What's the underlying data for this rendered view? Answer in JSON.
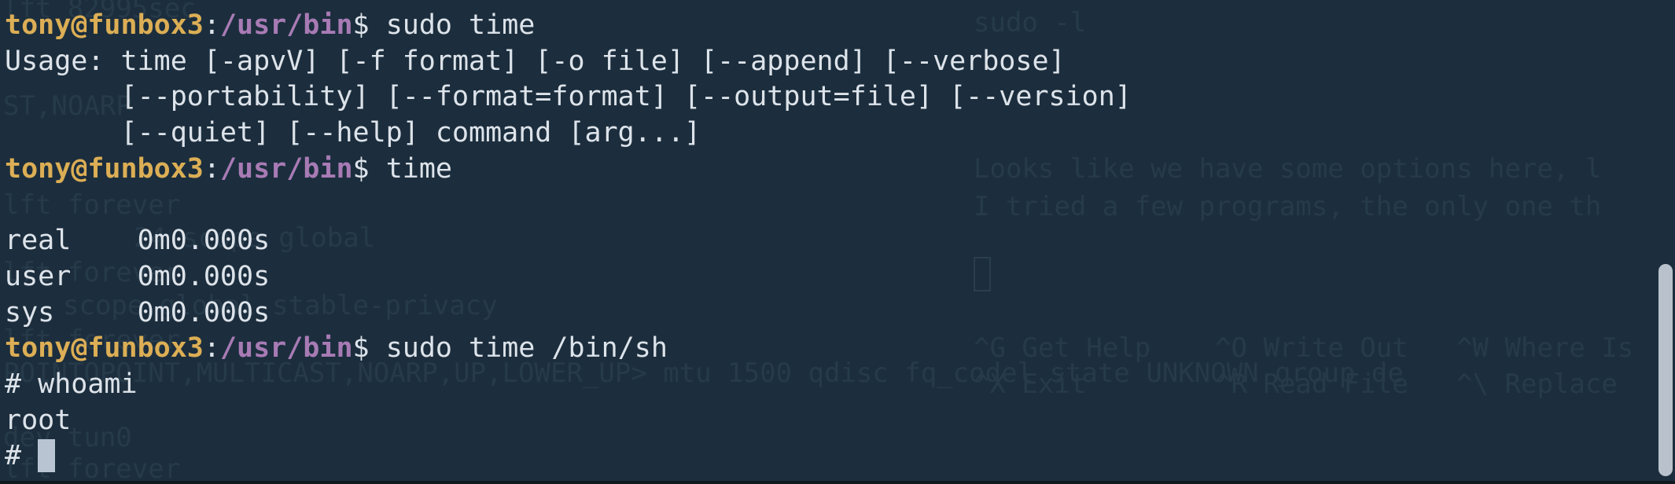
{
  "prompt": {
    "user_host": "tony@funbox3",
    "separator": ":",
    "path": "/usr/bin",
    "symbol": "$ "
  },
  "lines": {
    "l1_cmd": "sudo time",
    "l2": "Usage: time [-apvV] [-f format] [-o file] [--append] [--verbose]",
    "l3": "       [--portability] [--format=format] [--output=file] [--version]",
    "l4": "       [--quiet] [--help] command [arg...]",
    "l5_cmd": "time",
    "l6": "",
    "l7": "real\t0m0.000s",
    "l8": "user\t0m0.000s",
    "l9": "sys\t0m0.000s",
    "l10_cmd": "sudo time /bin/sh",
    "l11": "# whoami",
    "l12": "root",
    "l13": "# "
  },
  "background_ghost": {
    "left_1": "lft 82995sec",
    "left_2": "ST,NOARP",
    "left_3": "lft forever",
    "left_4": "24 scope global",
    "left_5": "lft forever",
    "left_6": "scope global stable-privacy",
    "left_7": "lft forever",
    "left_8": "POINTOPOINT,MULTICAST,NOARP,UP,LOWER_UP> mtu 1500 qdisc fq_codel state UNKNOWN group de",
    "left_9": "dev tun0",
    "left_10": "lft forever",
    "right_1": "sudo -l",
    "right_2": "Looks like we have some options here, l",
    "right_3": "I tried a few programs, the only one th",
    "right_4": "^G Get Help    ^O Write Out   ^W Where Is",
    "right_5": "^X Exit        ^R Read File   ^\\ Replace"
  },
  "colors": {
    "background": "#1c2e3d",
    "user_host": "#dcae55",
    "path": "#a87bb5",
    "text": "#dde3ea",
    "cursor": "#b9c4d3"
  },
  "icons": {
    "cursor": "block-cursor"
  }
}
